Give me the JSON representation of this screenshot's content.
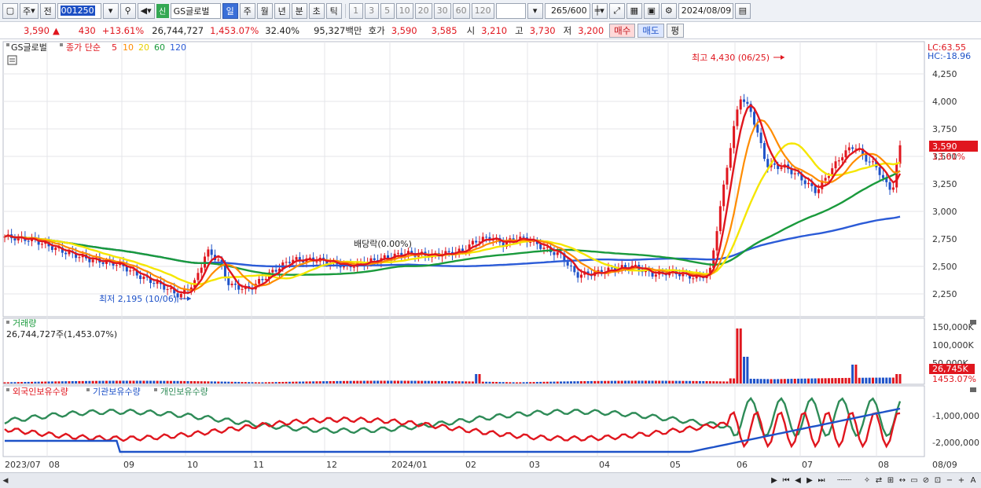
{
  "toolbar": {
    "period_select": "주",
    "prev_label": "전",
    "code": "001250",
    "stock_badge": "신",
    "stock_name": "GS글로벌",
    "periods": [
      "일",
      "주",
      "월",
      "년",
      "분",
      "초",
      "틱"
    ],
    "active_period": "일",
    "intervals": [
      "1",
      "3",
      "5",
      "10",
      "20",
      "30",
      "60",
      "120"
    ],
    "count": "265",
    "count_total": "/600",
    "date": "2024/08/09"
  },
  "quote": {
    "price": "3,590",
    "change": "430",
    "change_pct": "+13.61%",
    "volume": "26,744,727",
    "volume_pct": "1,453.07%",
    "turnover": "32.40%",
    "amount": "95,327백만",
    "bid_label": "호가",
    "bid1": "3,590",
    "bid2": "3,585",
    "open_label": "시",
    "open": "3,210",
    "high_label": "고",
    "high": "3,730",
    "low_label": "저",
    "low": "3,200",
    "buy_label": "매수",
    "sell_label": "매도",
    "avg_label": "평"
  },
  "legend": {
    "stock": "GS글로벌",
    "ma_title": "종가 단순",
    "ma5": "5",
    "ma10": "10",
    "ma20": "20",
    "ma60": "60",
    "ma120": "120",
    "lc": "LC:63.55",
    "hc": "HC:-18.96"
  },
  "annotations": {
    "high": "최고 4,430 (06/25)",
    "low": "최저 2,195 (10/06)",
    "dividend": "배당락(0.00%)"
  },
  "price_axis": [
    "4,250",
    "4,000",
    "3,750",
    "3,500",
    "3,250",
    "3,000",
    "2,750",
    "2,500",
    "2,250"
  ],
  "price_tag": "3,590",
  "price_tag_pct": "13.61%",
  "volume_panel": {
    "title": "거래량",
    "value": "26,744,727주(1,453.07%)",
    "axis": [
      "150,000K",
      "100,000K",
      "50,000K"
    ],
    "tag": "26,745K",
    "tag_pct": "1453.07%"
  },
  "holding_panel": {
    "foreign": "외국인보유수량",
    "institution": "기관보유수량",
    "individual": "개인보유수량",
    "axis": [
      "-1,000,000",
      "-2,000,000"
    ]
  },
  "time_axis": [
    "2023/07",
    "08",
    "09",
    "10",
    "11",
    "12",
    "2024/01",
    "02",
    "03",
    "04",
    "05",
    "06",
    "07",
    "08",
    "08/09"
  ],
  "colors": {
    "up": "#e0161e",
    "down": "#1e52c8",
    "ma5": "#e0161e",
    "ma10": "#ff8c00",
    "ma20": "#f5e600",
    "ma60": "#1a9a3c",
    "ma120": "#2b5bd7",
    "foreign": "#e0161e",
    "institution": "#1e52c8",
    "individual": "#2e8b57"
  }
}
